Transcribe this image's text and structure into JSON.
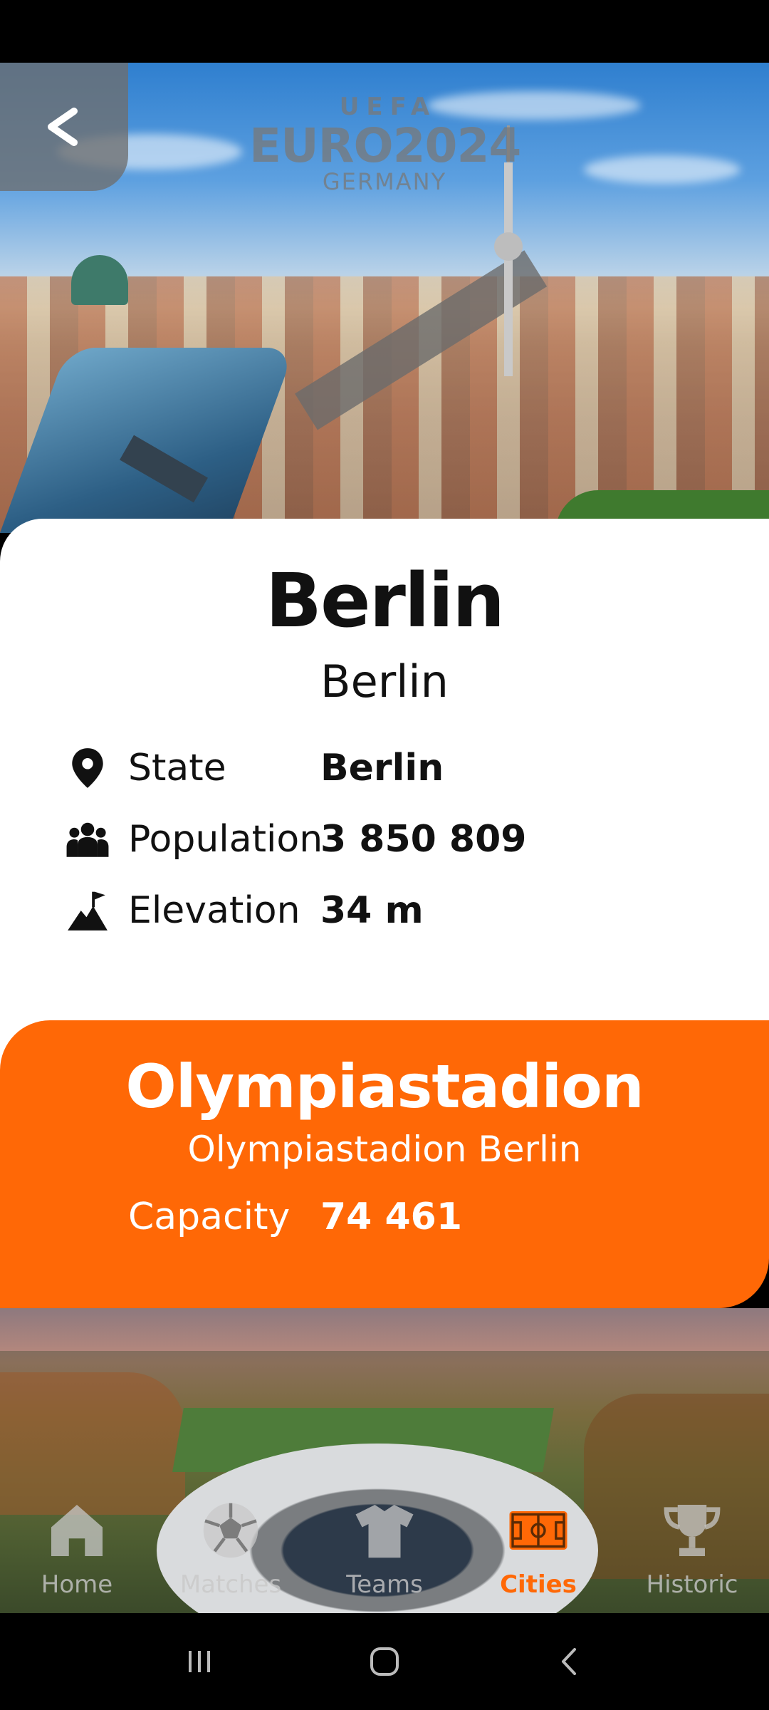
{
  "hero": {
    "logo": {
      "arc": "UEFA",
      "main": "EURO2024",
      "sub": "GERMANY"
    },
    "back_icon": "chevron-left-icon"
  },
  "city": {
    "title": "Berlin",
    "subtitle": "Berlin",
    "stats": [
      {
        "icon": "location-pin-icon",
        "label": "State",
        "value": "Berlin"
      },
      {
        "icon": "people-group-icon",
        "label": "Population",
        "value": "3 850 809"
      },
      {
        "icon": "mountain-flag-icon",
        "label": "Elevation",
        "value": "34 m"
      }
    ]
  },
  "stadium": {
    "name": "Olympiastadion",
    "full_name": "Olympiastadion Berlin",
    "capacity_label": "Capacity",
    "capacity_value": "74 461"
  },
  "tabs": [
    {
      "icon": "home-icon",
      "label": "Home",
      "active": false
    },
    {
      "icon": "soccer-ball-icon",
      "label": "Matches",
      "active": false
    },
    {
      "icon": "jersey-icon",
      "label": "Teams",
      "active": false
    },
    {
      "icon": "stadium-pitch-icon",
      "label": "Cities",
      "active": true
    },
    {
      "icon": "trophy-icon",
      "label": "Historic",
      "active": false
    }
  ],
  "colors": {
    "accent": "#ff6806",
    "text": "#111111",
    "card": "#ffffff"
  },
  "system_nav": [
    "recent-apps-icon",
    "home-circle-icon",
    "back-icon"
  ]
}
